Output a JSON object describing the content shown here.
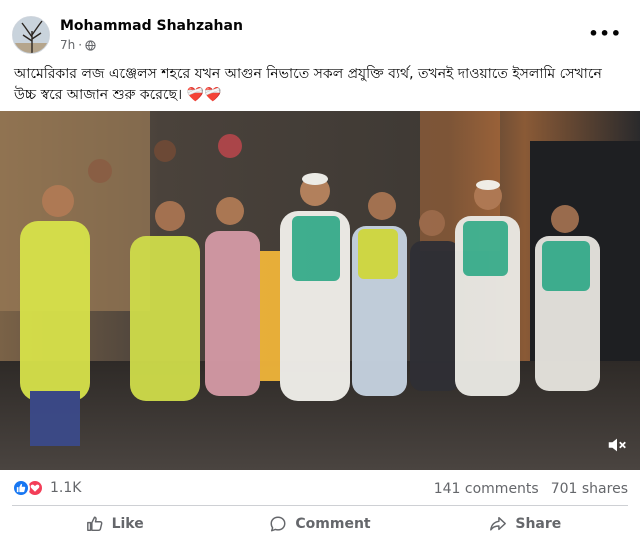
{
  "post": {
    "author": "Mohammad Shahzahan",
    "time": "7h",
    "time_separator": "·",
    "caption": "আমেরিকার লজ এঞ্জেলস শহরে যখন আগুন নিভাতে সকল প্রযুক্তি ব্যর্থ, তখনই দাওয়াতে ইসলামি সেখানে উচ্চ স্বরে আজান শুরু করেছে।",
    "caption_emoji": "❤️‍🩹❤️‍🩹",
    "more_label": "•••"
  },
  "icons": {
    "avatar": "avatar-image",
    "privacy": "globe-icon",
    "more": "more-options-icon",
    "mute": "volume-muted-icon",
    "like_reaction": "like-reaction-icon",
    "love_reaction": "love-reaction-icon",
    "like": "thumbs-up-icon",
    "comment": "comment-bubble-icon",
    "share": "share-arrow-icon"
  },
  "colors": {
    "accent": "#1877f2",
    "love": "#f33e58",
    "secondary_text": "#65676b"
  },
  "stats": {
    "reactions": "1.1K",
    "comments": "141 comments",
    "shares": "701 shares"
  },
  "actions": {
    "like": "Like",
    "comment": "Comment",
    "share": "Share"
  }
}
